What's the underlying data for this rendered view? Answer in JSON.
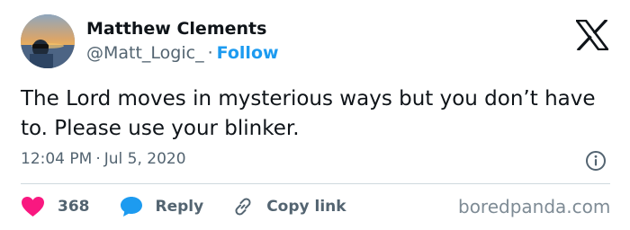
{
  "author": {
    "name": "Matthew Clements",
    "handle": "@Matt_Logic_",
    "separator": "·",
    "follow_label": "Follow"
  },
  "tweet": {
    "text": "The Lord moves in mysterious ways but you don’t have to. Please use your blinker.",
    "time": "12:04 PM",
    "separator": "·",
    "date": "Jul 5, 2020"
  },
  "actions": {
    "like_count": "368",
    "reply_label": "Reply",
    "copy_link_label": "Copy link"
  },
  "icons": {
    "platform": "x-logo-icon",
    "info": "info-icon",
    "like": "heart-icon",
    "reply": "speech-bubble-icon",
    "copy_link": "link-icon"
  },
  "colors": {
    "accent": "#1d9bf0",
    "like": "#f91880",
    "text": "#0f1419",
    "secondary_text": "#536471"
  },
  "watermark": "boredpanda.com"
}
